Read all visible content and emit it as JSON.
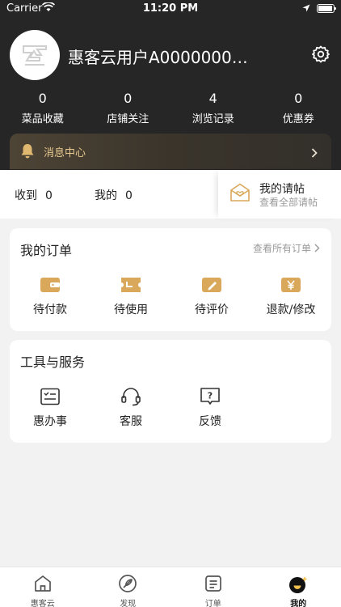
{
  "status_bar": {
    "carrier": "Carrier",
    "time": "11:20 PM"
  },
  "profile": {
    "username": "惠客云用户A0000000…"
  },
  "stats": [
    {
      "value": "0",
      "label": "菜品收藏"
    },
    {
      "value": "0",
      "label": "店铺关注"
    },
    {
      "value": "4",
      "label": "浏览记录"
    },
    {
      "value": "0",
      "label": "优惠券"
    }
  ],
  "message_center": {
    "label": "消息中心"
  },
  "inbox": {
    "received_label": "收到",
    "received_count": "0",
    "mine_label": "我的",
    "mine_count": "0",
    "invite_title": "我的请帖",
    "invite_subtitle": "查看全部请帖"
  },
  "orders": {
    "title": "我的订单",
    "view_all": "查看所有订单",
    "items": [
      {
        "label": "待付款",
        "icon": "wallet-icon"
      },
      {
        "label": "待使用",
        "icon": "ticket-icon"
      },
      {
        "label": "待评价",
        "icon": "pencil-icon"
      },
      {
        "label": "退款/修改",
        "icon": "yen-icon"
      }
    ]
  },
  "tools": {
    "title": "工具与服务",
    "items": [
      {
        "label": "惠办事",
        "icon": "checklist-icon"
      },
      {
        "label": "客服",
        "icon": "headset-icon"
      },
      {
        "label": "反馈",
        "icon": "feedback-icon"
      }
    ]
  },
  "tabbar": [
    {
      "label": "惠客云",
      "icon": "home-icon",
      "active": false
    },
    {
      "label": "发现",
      "icon": "discover-icon",
      "active": false
    },
    {
      "label": "订单",
      "icon": "order-icon",
      "active": false
    },
    {
      "label": "我的",
      "icon": "profile-icon",
      "active": true
    }
  ],
  "colors": {
    "gold": "#e8c98f",
    "icon_gold": "#d9a85a",
    "header_bg": "#262626"
  }
}
